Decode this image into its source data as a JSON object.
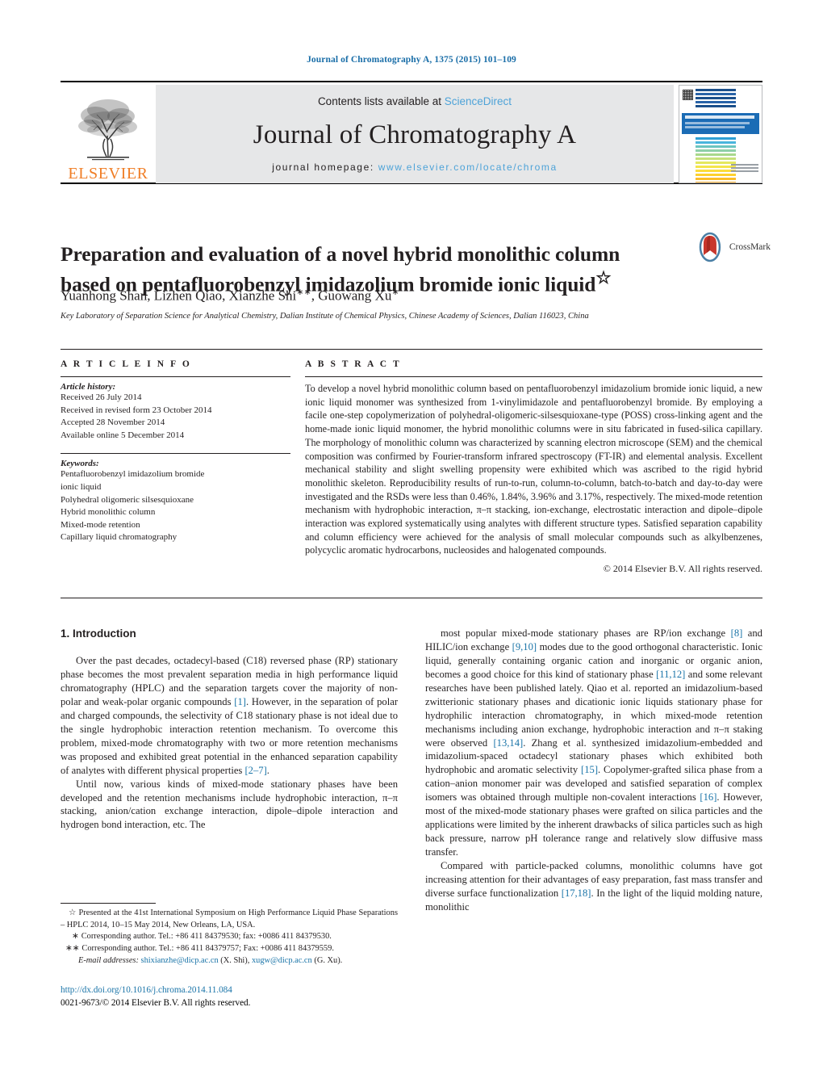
{
  "running_head": "Journal of Chromatography A, 1375 (2015) 101–109",
  "masthead": {
    "contents_prefix": "Contents lists available at ",
    "contents_link": "ScienceDirect",
    "journal_title": "Journal of Chromatography A",
    "homepage_prefix": "journal homepage: ",
    "homepage_url": "www.elsevier.com/locate/chroma",
    "publisher": "ELSEVIER"
  },
  "article": {
    "title": "Preparation and evaluation of a novel hybrid monolithic column based on pentafluorobenzyl imidazolium bromide ionic liquid",
    "title_footnote_mark": "☆",
    "authors": "Yuanhong Shan, Lizhen Qiao, Xianzhe Shi",
    "author_mark_1": "∗∗",
    "authors_tail": ", Guowang Xu",
    "author_mark_2": "∗",
    "affiliation": "Key Laboratory of Separation Science for Analytical Chemistry, Dalian Institute of Chemical Physics, Chinese Academy of Sciences, Dalian 116023, China",
    "crossmark_label": "CrossMark"
  },
  "article_info": {
    "heading": "A R T I C L E     I N F O",
    "history_label": "Article history:",
    "history": [
      "Received 26 July 2014",
      "Received in revised form 23 October 2014",
      "Accepted 28 November 2014",
      "Available online 5 December 2014"
    ],
    "keywords_label": "Keywords:",
    "keywords": [
      "Pentafluorobenzyl imidazolium bromide",
      "ionic liquid",
      "Polyhedral oligomeric silsesquioxane",
      "Hybrid monolithic column",
      "Mixed-mode retention",
      "Capillary liquid chromatography"
    ]
  },
  "abstract": {
    "heading": "A B S T R A C T",
    "text": "To develop a novel hybrid monolithic column based on pentafluorobenzyl imidazolium bromide ionic liquid, a new ionic liquid monomer was synthesized from 1-vinylimidazole and pentafluorobenzyl bromide. By employing a facile one-step copolymerization of polyhedral-oligomeric-silsesquioxane-type (POSS) cross-linking agent and the home-made ionic liquid monomer, the hybrid monolithic columns were in situ fabricated in fused-silica capillary. The morphology of monolithic column was characterized by scanning electron microscope (SEM) and the chemical composition was confirmed by Fourier-transform infrared spectroscopy (FT-IR) and elemental analysis. Excellent mechanical stability and slight swelling propensity were exhibited which was ascribed to the rigid hybrid monolithic skeleton. Reproducibility results of run-to-run, column-to-column, batch-to-batch and day-to-day were investigated and the RSDs were less than 0.46%, 1.84%, 3.96% and 3.17%, respectively. The mixed-mode retention mechanism with hydrophobic interaction, π–π stacking, ion-exchange, electrostatic interaction and dipole–dipole interaction was explored systematically using analytes with different structure types. Satisfied separation capability and column efficiency were achieved for the analysis of small molecular compounds such as alkylbenzenes, polycyclic aromatic hydrocarbons, nucleosides and halogenated compounds.",
    "copyright": "© 2014 Elsevier B.V. All rights reserved."
  },
  "introduction": {
    "heading": "1.  Introduction",
    "left_p1_a": "Over the past decades, octadecyl-based (C18) reversed phase (RP) stationary phase becomes the most prevalent separation media in high performance liquid chromatography (HPLC) and the separation targets cover the majority of non-polar and weak-polar organic compounds ",
    "left_p1_ref1": "[1]",
    "left_p1_b": ". However, in the separation of polar and charged compounds, the selectivity of C18 stationary phase is not ideal due to the single hydrophobic interaction retention mechanism. To overcome this problem, mixed-mode chromatography with two or more retention mechanisms was proposed and exhibited great potential in the enhanced separation capability of analytes with different physical properties ",
    "left_p1_ref2": "[2–7]",
    "left_p1_c": ".",
    "left_p2": "Until now, various kinds of mixed-mode stationary phases have been developed and the retention mechanisms include hydrophobic interaction, π–π stacking, anion/cation exchange interaction, dipole–dipole interaction and hydrogen bond interaction, etc. The",
    "right_p1_a": "most popular mixed-mode stationary phases are RP/ion exchange ",
    "right_p1_ref1": "[8]",
    "right_p1_b": " and HILIC/ion exchange ",
    "right_p1_ref2": "[9,10]",
    "right_p1_c": " modes due to the good orthogonal characteristic. Ionic liquid, generally containing organic cation and inorganic or organic anion, becomes a good choice for this kind of stationary phase ",
    "right_p1_ref3": "[11,12]",
    "right_p1_d": " and some relevant researches have been published lately. Qiao et al. reported an imidazolium-based zwitterionic stationary phases and dicationic ionic liquids stationary phase for hydrophilic interaction chromatography, in which mixed-mode retention mechanisms including anion exchange, hydrophobic interaction and π–π staking were observed ",
    "right_p1_ref4": "[13,14]",
    "right_p1_e": ". Zhang et al. synthesized imidazolium-embedded and imidazolium-spaced octadecyl stationary phases which exhibited both hydrophobic and aromatic selectivity ",
    "right_p1_ref5": "[15]",
    "right_p1_f": ". Copolymer-grafted silica phase from a cation–anion monomer pair was developed and satisfied separation of complex isomers was obtained through multiple non-covalent interactions ",
    "right_p1_ref6": "[16]",
    "right_p1_g": ". However, most of the mixed-mode stationary phases were grafted on silica particles and the applications were limited by the inherent drawbacks of silica particles such as high back pressure, narrow pH tolerance range and relatively slow diffusive mass transfer.",
    "right_p2_a": "Compared with particle-packed columns, monolithic columns have got increasing attention for their advantages of easy preparation, fast mass transfer and diverse surface functionalization ",
    "right_p2_ref1": "[17,18]",
    "right_p2_b": ". In the light of the liquid molding nature, monolithic"
  },
  "footnotes": {
    "symposium_mark": "☆",
    "symposium": "Presented at the 41st International Symposium on High Performance Liquid Phase Separations – HPLC 2014, 10–15 May 2014, New Orleans, LA, USA.",
    "corr1_mark": "∗",
    "corr1": "Corresponding author. Tel.: +86 411 84379530; fax: +0086 411 84379530.",
    "corr2_mark": "∗∗",
    "corr2": "Corresponding author. Tel.: +86 411 84379757; Fax: +0086 411 84379559.",
    "email_label": "E-mail addresses:",
    "email_1": "shixianzhe@dicp.ac.cn",
    "email_1_owner": "(X. Shi),",
    "email_2": "xugw@dicp.ac.cn",
    "email_2_owner": "(G. Xu)."
  },
  "footer": {
    "doi": "http://dx.doi.org/10.1016/j.chroma.2014.11.084",
    "issn_line": "0021-9673/© 2014 Elsevier B.V. All rights reserved."
  },
  "colors": {
    "link_blue": "#1a74a8",
    "sciencedirect_blue": "#4ea3d8",
    "elsevier_orange": "#F07E26",
    "masthead_gray": "#e6e7e8",
    "cover_band_blue": "#1b6cb5"
  }
}
